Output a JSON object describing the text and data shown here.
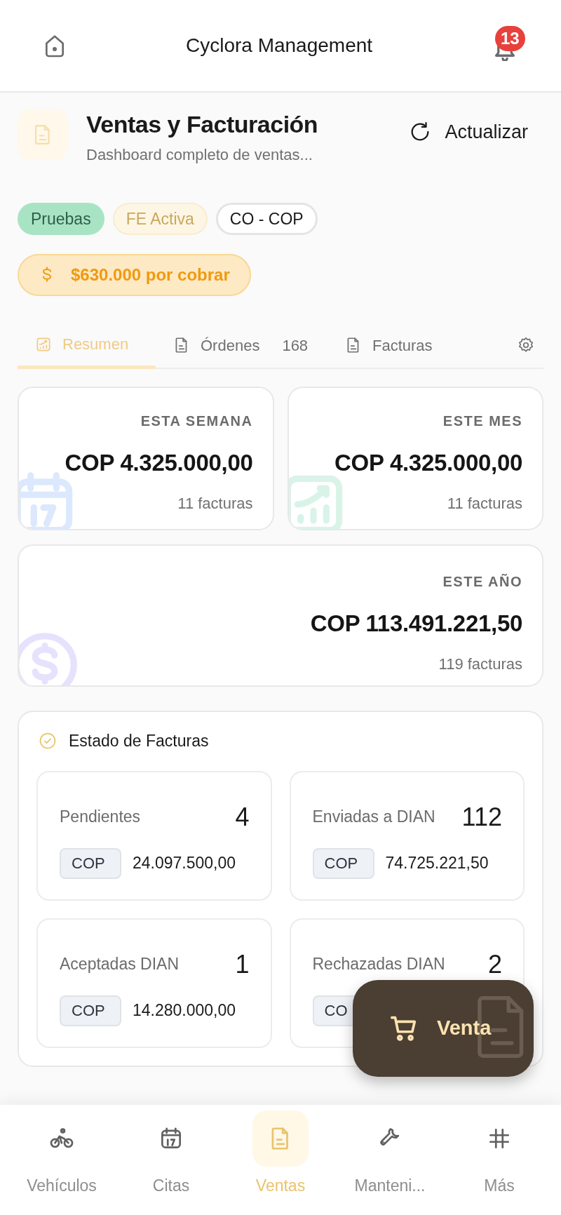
{
  "header": {
    "title": "Cyclora Management",
    "notification_count": "13"
  },
  "page": {
    "title": "Ventas y Facturación",
    "subtitle": "Dashboard completo de ventas...",
    "refresh_label": "Actualizar"
  },
  "tags": [
    {
      "label": "Pruebas",
      "kind": "success"
    },
    {
      "label": "FE Activa",
      "kind": "faded"
    },
    {
      "label": "CO - COP",
      "kind": "outline"
    }
  ],
  "pending_pill": {
    "label": "$630.000 por cobrar"
  },
  "tabs": [
    {
      "label": "Resumen",
      "kind": "chart",
      "selected": true
    },
    {
      "label": "Órdenes",
      "kind": "document",
      "count": "168",
      "selected": false
    },
    {
      "label": "Facturas",
      "kind": "document",
      "selected": false
    },
    {
      "kind": "settings",
      "selected": false
    }
  ],
  "period_cards": [
    {
      "label": "ESTA SEMANA",
      "amount": "COP 4.325.000,00",
      "count": "11 facturas",
      "kind": "calendar"
    },
    {
      "label": "ESTE MES",
      "amount": "COP 4.325.000,00",
      "count": "11 facturas",
      "kind": "chart"
    },
    {
      "label": "ESTE AÑO",
      "amount": "COP 113.491.221,50",
      "count": "119 facturas",
      "kind": "dollar"
    }
  ],
  "invoice_status": {
    "title": "Estado de Facturas",
    "items": [
      {
        "label": "Pendientes",
        "count": "4",
        "currency": "COP",
        "amount": "24.097.500,00"
      },
      {
        "label": "Enviadas a DIAN",
        "count": "112",
        "currency": "COP",
        "amount": "74.725.221,50"
      },
      {
        "label": "Aceptadas DIAN",
        "count": "1",
        "currency": "COP",
        "amount": "14.280.000,00"
      },
      {
        "label": "Rechazadas DIAN",
        "count": "2",
        "currency": "CO"
      }
    ]
  },
  "fab": {
    "label": "Venta"
  },
  "bottom_nav": [
    {
      "label": "Vehículos",
      "kind": "bike",
      "selected": false
    },
    {
      "label": "Citas",
      "kind": "calendar",
      "selected": false
    },
    {
      "label": "Ventas",
      "kind": "document",
      "selected": true
    },
    {
      "label": "Manteni...",
      "kind": "wrench",
      "selected": false
    },
    {
      "label": "Más",
      "kind": "grid",
      "selected": false
    }
  ]
}
